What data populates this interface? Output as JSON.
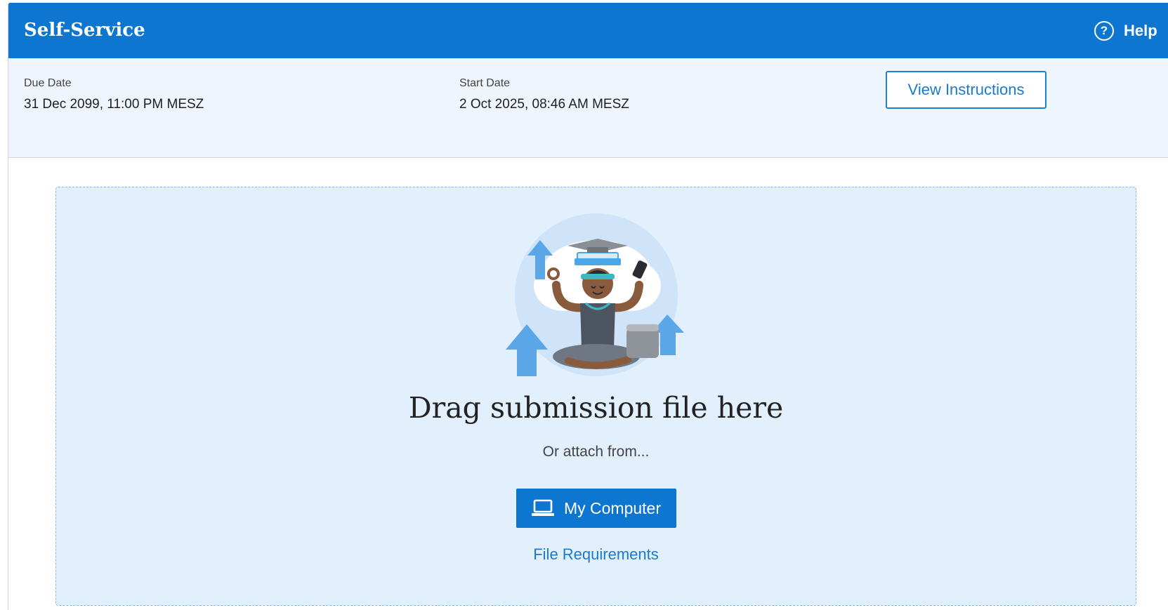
{
  "header": {
    "title": "Self-Service",
    "help_label": "Help",
    "help_icon": "question-circle-icon"
  },
  "info": {
    "due_label": "Due Date",
    "due_value": "31 Dec 2099, 11:00 PM MESZ",
    "start_label": "Start Date",
    "start_value": "2 Oct 2025, 08:46 AM MESZ",
    "view_instructions": "View Instructions"
  },
  "dropzone": {
    "title": "Drag submission file here",
    "attach_text": "Or attach from...",
    "my_computer": "My Computer",
    "my_computer_icon": "laptop-icon",
    "file_requirements": "File Requirements"
  },
  "colors": {
    "brand": "#0d76d1",
    "info_bg": "#eef5fc",
    "drop_bg": "#e2effc",
    "link": "#1a7acf"
  }
}
